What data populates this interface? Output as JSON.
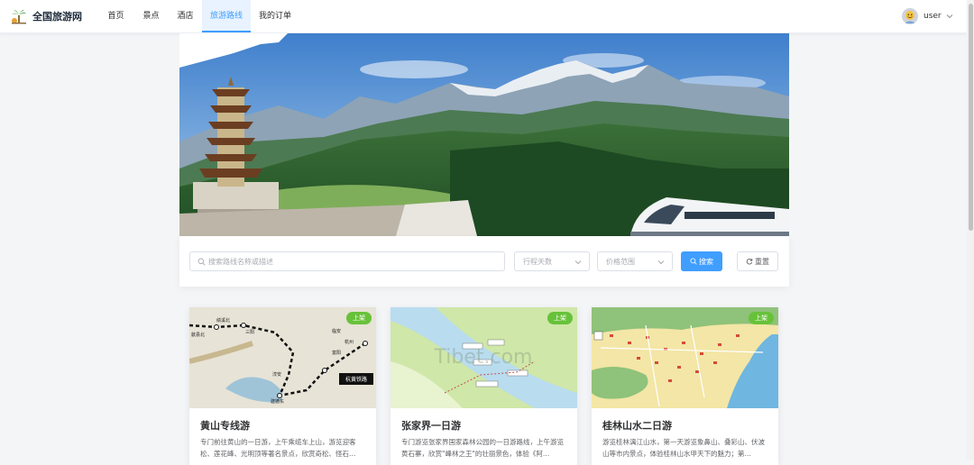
{
  "header": {
    "brand": {
      "name": "全国旅游网",
      "logo_icon": "palm-tree-icon"
    },
    "nav": [
      {
        "label": "首页",
        "active": false
      },
      {
        "label": "景点",
        "active": false
      },
      {
        "label": "酒店",
        "active": false
      },
      {
        "label": "旅游路线",
        "active": true
      },
      {
        "label": "我的订单",
        "active": false
      }
    ],
    "user": {
      "name": "user",
      "avatar_icon": "avatar-icon"
    }
  },
  "banner": {
    "description_icons": [
      "pagoda-icon",
      "mountain-icon",
      "train-icon"
    ]
  },
  "search": {
    "placeholder": "搜索路线名称或描述",
    "days_placeholder": "行程天数",
    "price_placeholder": "价格范围",
    "search_label": "搜索",
    "reset_label": "重置"
  },
  "routes": [
    {
      "title": "黄山专线游",
      "status": "上架",
      "description": "专门前往黄山的一日游，上午乘缆车上山，游览迎客松、莲花峰、光明顶等著名景点，欣赏奇松、怪石…",
      "map_labels": [
        "绩溪北",
        "三阳",
        "临安",
        "杭州",
        "富阳",
        "淳安",
        "建德东",
        "歙县北",
        "杭黄铁路"
      ]
    },
    {
      "title": "张家界一日游",
      "status": "上架",
      "description": "专门游览张家界国家森林公园的一日游路线，上午游览黄石寨，欣赏\"峰林之王\"的壮丽景色，体验《阿…",
      "watermark": "Tibet.com"
    },
    {
      "title": "桂林山水二日游",
      "status": "上架",
      "description": "游览桂林漓江山水，第一天游览象鼻山、叠彩山、伏波山等市内景点，体验桂林山水甲天下的魅力；第…"
    }
  ],
  "colors": {
    "primary": "#409eff",
    "badge": "#67c23a",
    "page_bg": "#f4f5f7"
  }
}
